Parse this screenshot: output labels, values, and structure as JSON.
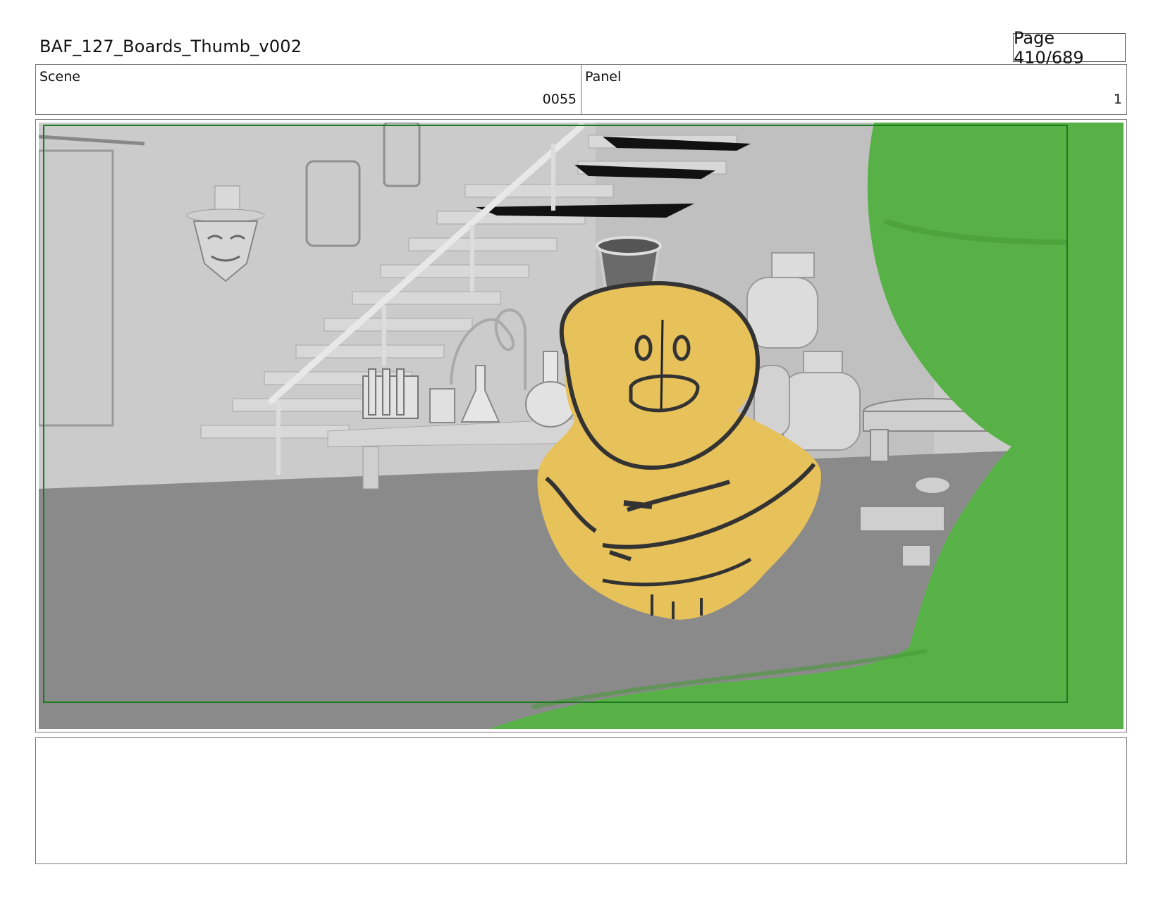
{
  "header": {
    "title": "BAF_127_Boards_Thumb_v002",
    "page": "Page 410/689"
  },
  "info": {
    "scene_label": "Scene",
    "scene_value": "0055",
    "panel_label": "Panel",
    "panel_value": "1"
  },
  "frame": {
    "description_items": [
      "grey-3d-basement-set",
      "staircase",
      "lab-bench",
      "glassware",
      "gas-tanks",
      "yellow-character-sketch",
      "green-foreground-shape"
    ],
    "colors": {
      "set_grey": "#c8c8c8",
      "floor_grey": "#8a8a8a",
      "character_yellow": "#e7c15a",
      "foreground_green": "#58b147",
      "frame_border": "#1e7a1e"
    }
  },
  "notes": {
    "text": ""
  }
}
